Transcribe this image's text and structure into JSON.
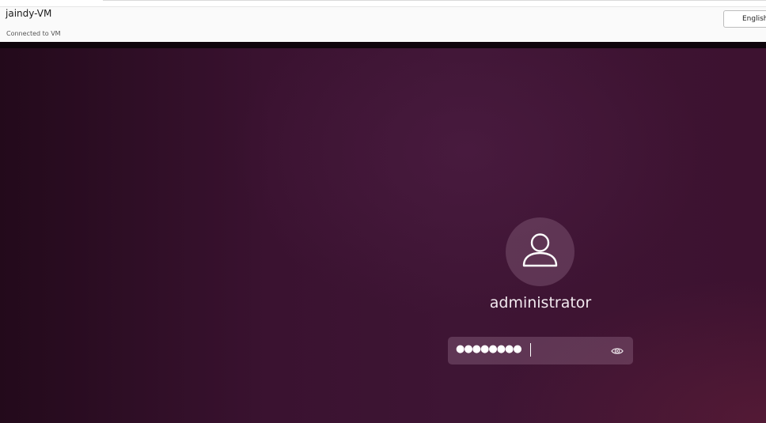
{
  "header": {
    "vm_name": "jaindy-VM",
    "status": "Connected to VM",
    "language": "English"
  },
  "login": {
    "username": "administrator",
    "password_mask": "●●●●●●●●",
    "avatar_icon": "user-icon",
    "reveal_icon": "eye-icon"
  },
  "colors": {
    "background": "#3a1230",
    "field": "#6e4a64",
    "text": "#f2e9ef"
  }
}
